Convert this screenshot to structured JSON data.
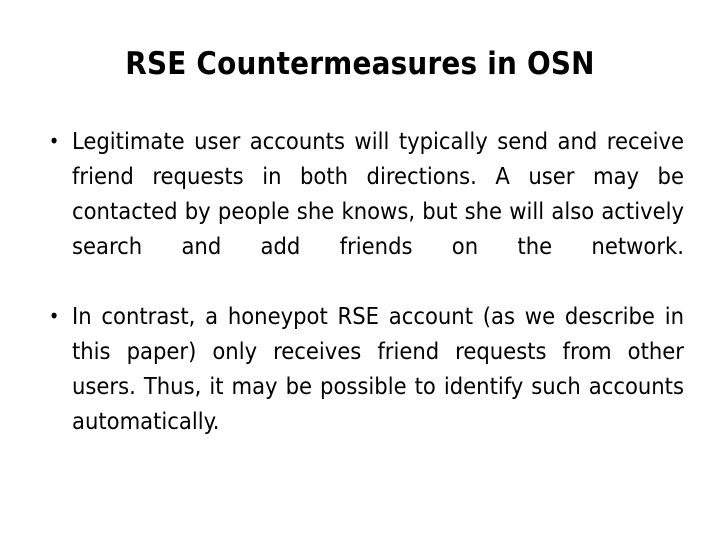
{
  "slide": {
    "title": "RSE Countermeasures in OSN",
    "background_color": "#ffffff",
    "text_color": "#000000",
    "bullet_glyph": "•",
    "bullets": [
      {
        "text": "Legitimate user accounts will typically send and receive friend requests in both directions. A user may be contacted by people she knows, but she will also actively search and add friends on the network."
      },
      {
        "text": "In contrast, a honeypot RSE account (as we describe in this paper) only receives friend requests from other users. Thus, it may be possible to identify such accounts automatically."
      }
    ]
  }
}
